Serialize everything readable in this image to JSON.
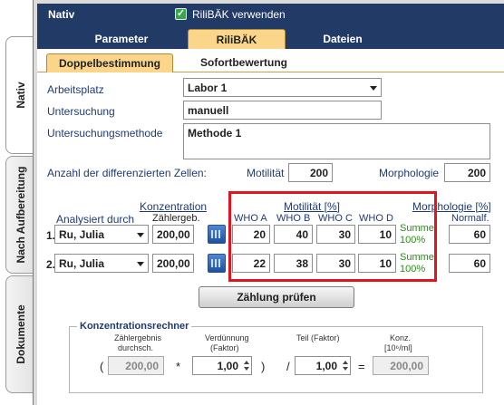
{
  "side_tabs": [
    "Nativ",
    "Nach Aufbereitung",
    "Dokumente"
  ],
  "header": {
    "title": "Nativ",
    "checkbox_label": "RiliBÄK verwenden",
    "checkbox_checked": true
  },
  "tabs_top": [
    "Parameter",
    "RiliBÄK",
    "Dateien"
  ],
  "tabs_sub": [
    "Doppelbestimmung",
    "Sofortbewertung"
  ],
  "form": {
    "arbeitsplatz_label": "Arbeitsplatz",
    "arbeitsplatz_value": "Labor 1",
    "untersuchung_label": "Untersuchung",
    "untersuchung_value": "manuell",
    "methode_label": "Untersuchungsmethode",
    "methode_value": "Methode 1",
    "anzahl_label": "Anzahl der differenzierten Zellen:",
    "motilitaet_label": "Motilität",
    "motilitaet_value": "200",
    "morphologie_label": "Morphologie",
    "morphologie_value": "200"
  },
  "table": {
    "konzentration": "Konzentration",
    "analysiert": "Analysiert durch",
    "zaehlergeb": "Zählergeb.",
    "motilitaet": "Motilität [%]",
    "who": [
      "WHO A",
      "WHO B",
      "WHO C",
      "WHO  D"
    ],
    "morphologie": "Morphologie [%]",
    "normalf": "Normalf.",
    "rows": [
      {
        "num": "1.",
        "name": "Ru, Julia",
        "count": "200,00",
        "a": "20",
        "b": "40",
        "c": "30",
        "d": "10",
        "summe": "Summe:",
        "summe_val": "100%",
        "normal": "60"
      },
      {
        "num": "2.",
        "name": "Ru, Julia",
        "count": "200,00",
        "a": "22",
        "b": "38",
        "c": "30",
        "d": "10",
        "summe": "Summe:",
        "summe_val": "100%",
        "normal": "60"
      }
    ]
  },
  "check_button": "Zählung prüfen",
  "rechner": {
    "title": "Konzentrationsrechner",
    "col1": [
      "Zählergebnis",
      "durchsch."
    ],
    "col2": [
      "Verdünnung",
      "(Faktor)"
    ],
    "col3": "Teil (Faktor)",
    "col4": [
      "Konz.",
      "[10⁶/ml]"
    ],
    "open": "(",
    "times": "*",
    "close": ")",
    "slash": "/",
    "equals": "=",
    "v1": "200,00",
    "v2": "1,00",
    "v3": "1,00",
    "v4": "200,00"
  },
  "colors": {
    "header": "#223a66",
    "accent": "#fbd68a",
    "highlight": "#e3141d",
    "label": "#1f3a78",
    "ok": "#2f8a1e"
  }
}
